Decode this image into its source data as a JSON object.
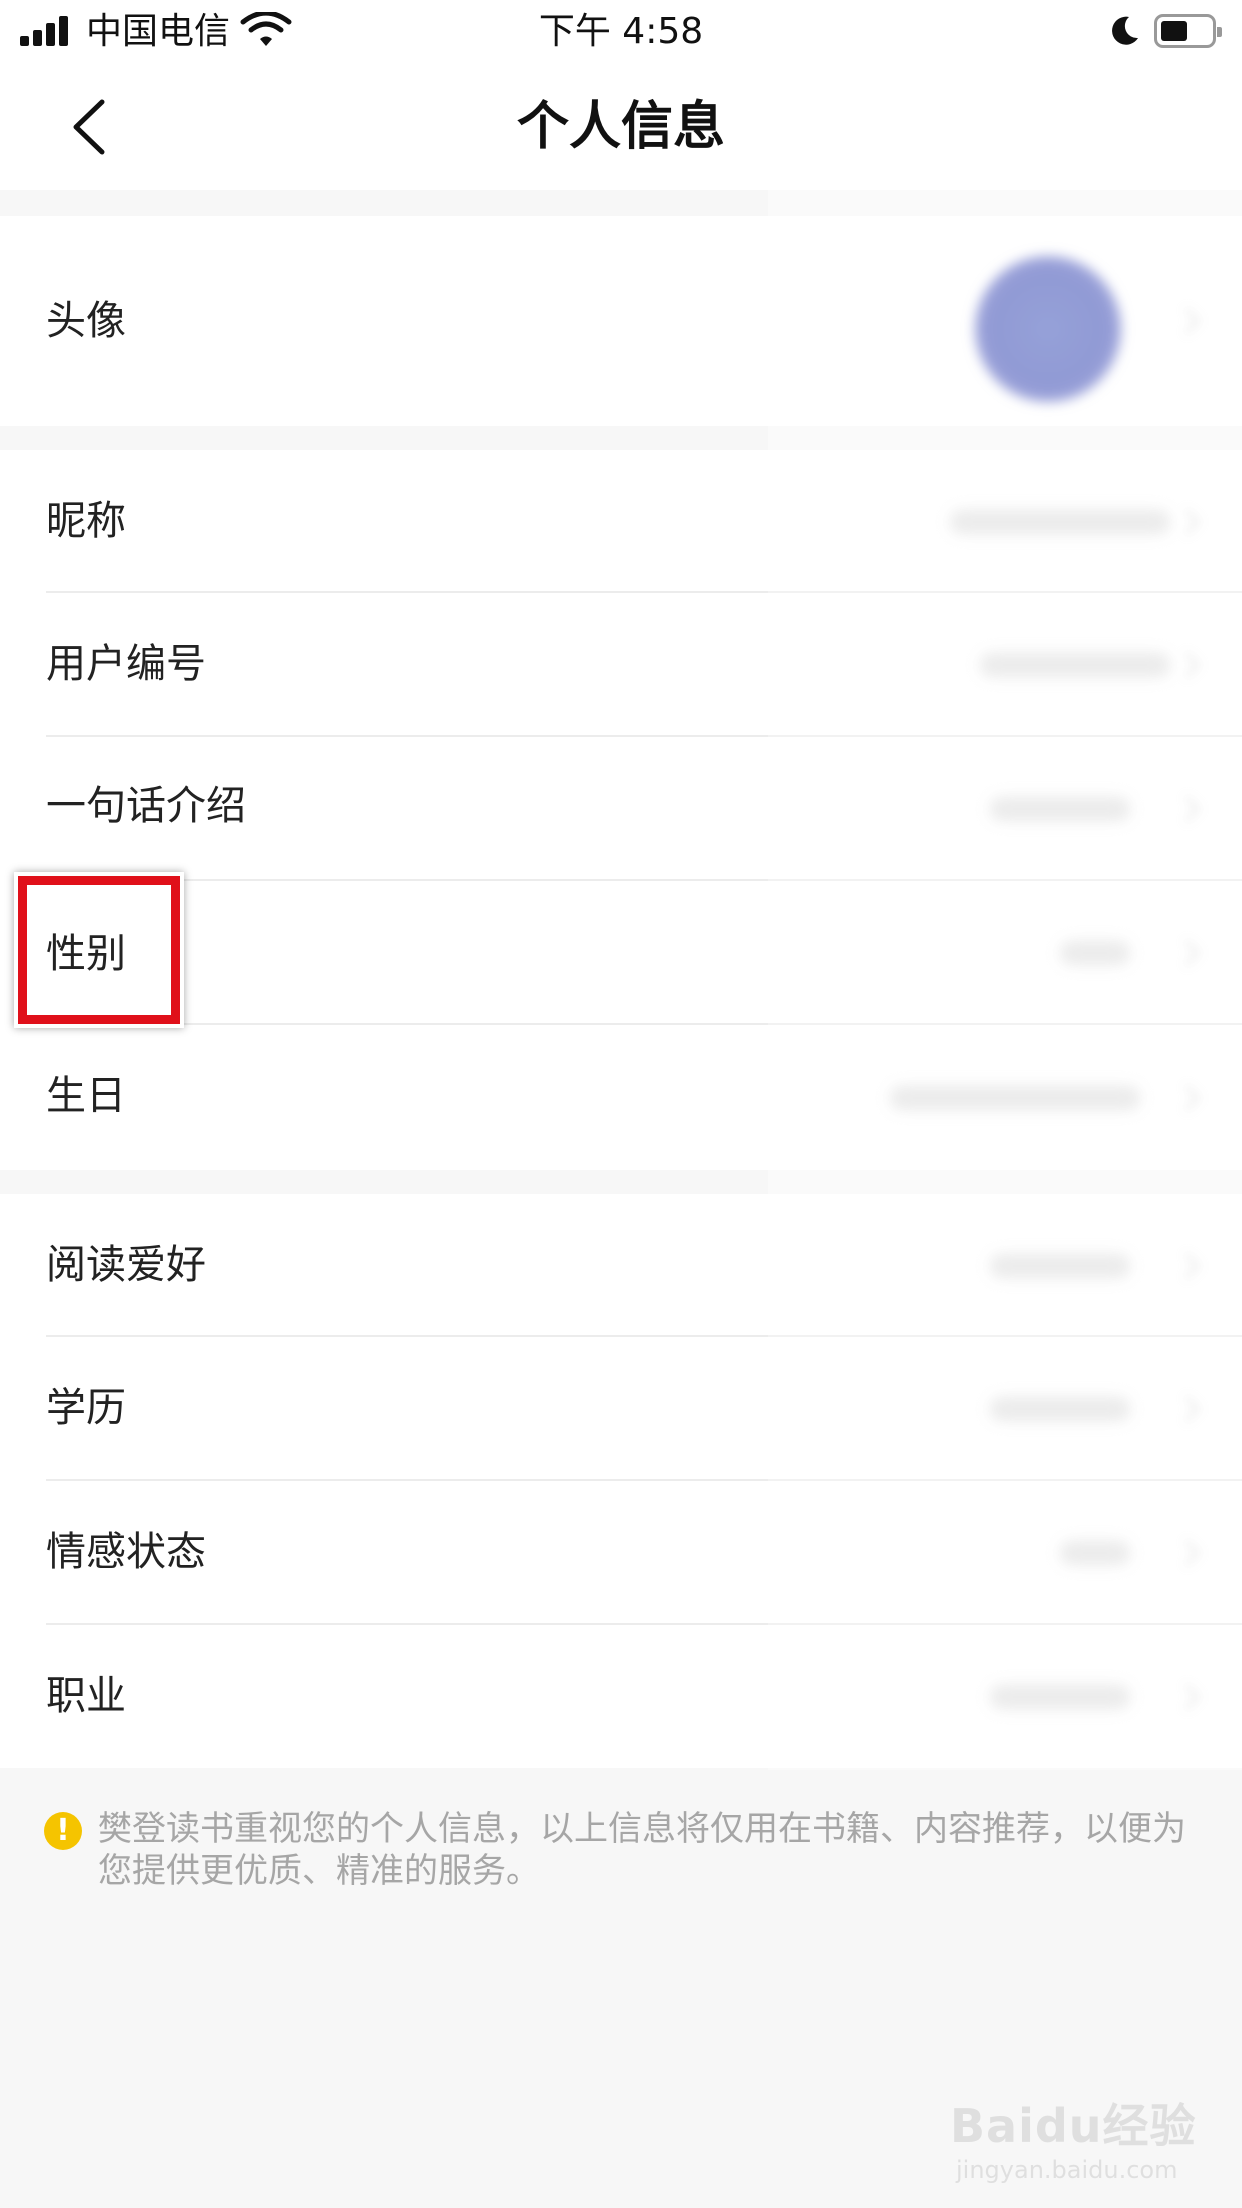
{
  "status_bar": {
    "carrier": "中国电信",
    "time": "下午 4:58"
  },
  "nav": {
    "title": "个人信息"
  },
  "rows": {
    "avatar": "头像",
    "nickname": "昵称",
    "user_id": "用户编号",
    "intro": "一句话介绍",
    "gender": "性别",
    "birthday": "生日",
    "reading": "阅读爱好",
    "education": "学历",
    "relationship": "情感状态",
    "occupation": "职业"
  },
  "notice": {
    "icon": "!",
    "text": "樊登读书重视您的个人信息，以上信息将仅用在书籍、内容推荐，以便为您提供更优质、精准的服务。"
  },
  "watermark": {
    "main": "Baidu经验",
    "sub": "jingyan.baidu.com"
  },
  "colors": {
    "highlight": "#e0101a",
    "notice_icon": "#f5c400"
  }
}
